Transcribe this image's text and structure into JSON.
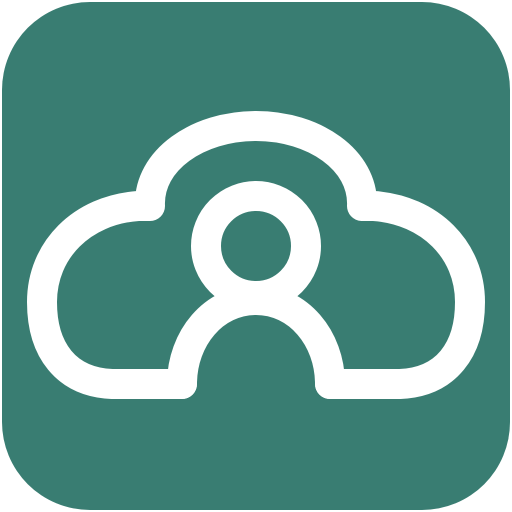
{
  "icon": {
    "name": "cloud-user-icon",
    "background_color": "#397d72",
    "foreground_color": "#ffffff"
  }
}
